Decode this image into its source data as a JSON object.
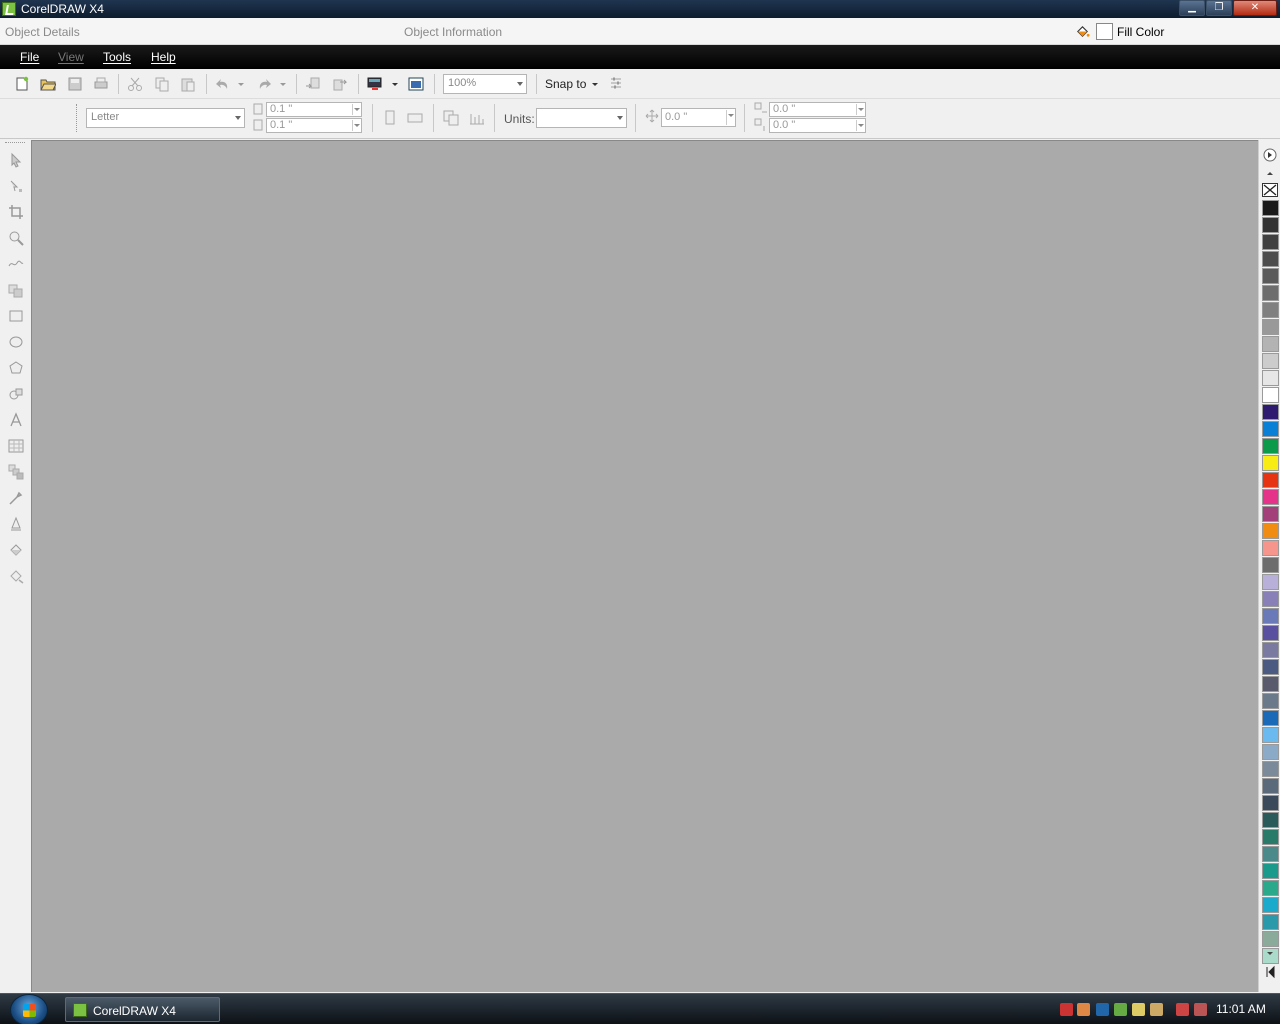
{
  "window": {
    "title": "CorelDRAW X4",
    "controls": [
      "minimize",
      "maximize",
      "close"
    ]
  },
  "object_bar": {
    "details": "Object Details",
    "information": "Object Information",
    "fill_label": "Fill Color",
    "fill_color": "#ffffff"
  },
  "menu": [
    {
      "label": "File",
      "enabled": true
    },
    {
      "label": "View",
      "enabled": false
    },
    {
      "label": "Tools",
      "enabled": true
    },
    {
      "label": "Help",
      "enabled": true
    }
  ],
  "toolbar": {
    "zoom": "100%",
    "snap_label": "Snap to",
    "icons": [
      "new-icon",
      "open-icon",
      "save-icon",
      "print-icon",
      "cut-icon",
      "copy-icon",
      "paste-icon",
      "undo-icon",
      "redo-icon",
      "import-icon",
      "export-icon",
      "application-launcher-icon",
      "welcome-screen-icon",
      "options-icon"
    ]
  },
  "property_bar": {
    "paper_size": "Letter",
    "width": "0.1 \"",
    "height": "0.1 \"",
    "units_label": "Units:",
    "units_value": "",
    "nudge": "0.0 \"",
    "duplicate_x": "0.0 \"",
    "duplicate_y": "0.0 \""
  },
  "toolbox": [
    "pick-tool-icon",
    "shape-tool-icon",
    "crop-tool-icon",
    "zoom-tool-icon",
    "freehand-tool-icon",
    "smart-fill-icon",
    "rectangle-tool-icon",
    "ellipse-tool-icon",
    "polygon-tool-icon",
    "basic-shapes-icon",
    "text-tool-icon",
    "table-tool-icon",
    "interactive-blend-icon",
    "eyedropper-icon",
    "outline-tool-icon",
    "fill-tool-icon",
    "interactive-fill-icon"
  ],
  "palette": {
    "colors": [
      "#1a1a1a",
      "#333333",
      "#404040",
      "#4d4d4d",
      "#5a5a5a",
      "#6d6d6d",
      "#808080",
      "#999999",
      "#b3b3b3",
      "#cccccc",
      "#e6e6e6",
      "#ffffff",
      "#2e1a6e",
      "#0a7fd6",
      "#0a9a49",
      "#f7ed15",
      "#e63312",
      "#e6338a",
      "#a3407a",
      "#f08c12",
      "#f5958c",
      "#6d6d6d",
      "#b8b0d8",
      "#8a80b8",
      "#6a7ab8",
      "#5a50a0",
      "#7a7aa0",
      "#4a5a80",
      "#5a5a6d",
      "#6a7a8a",
      "#1a6ab8",
      "#6abaf0",
      "#8aaac8",
      "#7a8a9a",
      "#5a6a7a",
      "#3a4a5a",
      "#2a5a5a",
      "#2a7a6a",
      "#4a8a8a",
      "#1a9a8a",
      "#2aaa8a",
      "#1aaacc",
      "#2a9aaa",
      "#8aaa9a",
      "#aadaca"
    ]
  },
  "taskbar": {
    "task_label": "CorelDRAW X4",
    "clock": "11:01 AM"
  }
}
